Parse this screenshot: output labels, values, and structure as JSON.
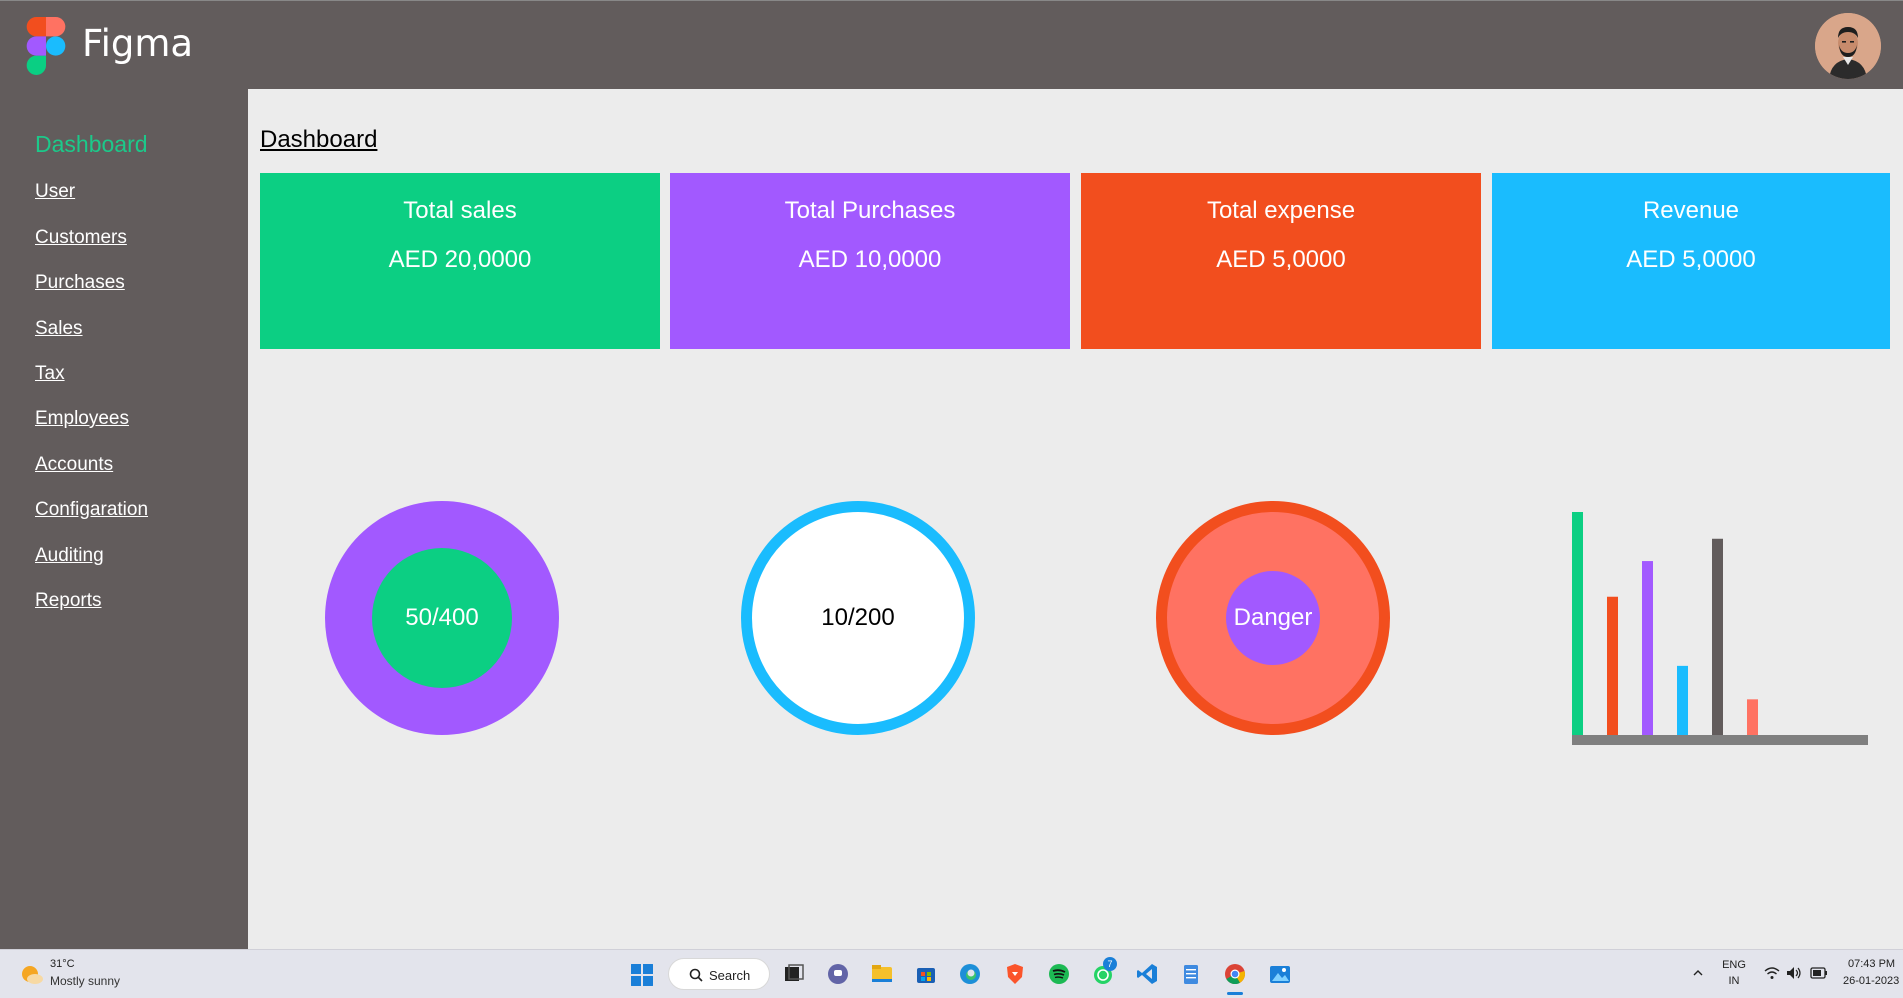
{
  "app": {
    "name": "Figma"
  },
  "sidebar": {
    "active": "Dashboard",
    "items": [
      {
        "label": "User"
      },
      {
        "label": "Customers"
      },
      {
        "label": "Purchases"
      },
      {
        "label": "Sales"
      },
      {
        "label": "Tax"
      },
      {
        "label": "Employees"
      },
      {
        "label": "Accounts"
      },
      {
        "label": "Configaration"
      },
      {
        "label": "Auditing"
      },
      {
        "label": "Reports"
      }
    ]
  },
  "main": {
    "title": "Dashboard",
    "cards": [
      {
        "title": "Total sales",
        "value": "AED 20,0000",
        "color": "#0ccf83"
      },
      {
        "title": "Total Purchases",
        "value": "AED 10,0000",
        "color": "#a259ff"
      },
      {
        "title": "Total expense",
        "value": "AED 5,0000",
        "color": "#f24e1e"
      },
      {
        "title": "Revenue",
        "value": "AED 5,0000",
        "color": "#1abcfe"
      }
    ],
    "rings": [
      {
        "label": "50/400",
        "outer_color": "#a259ff",
        "inner_color": "#0ccf83"
      },
      {
        "label": "10/200",
        "ring_color": "#1abcfe"
      },
      {
        "label": "Danger",
        "outer_color": "#f24e1e",
        "fill_color": "#ff7262",
        "inner_color": "#a259ff"
      }
    ]
  },
  "chart_data": {
    "type": "bar",
    "categories": [
      "",
      "",
      "",
      "",
      "",
      ""
    ],
    "values": [
      100,
      62,
      78,
      31,
      88,
      16
    ],
    "colors": [
      "#0ccf83",
      "#f24e1e",
      "#a259ff",
      "#1abcfe",
      "#625c5c",
      "#ff7262"
    ],
    "ylim": [
      0,
      100
    ],
    "grid": false,
    "axis_color": "#7f7f7f"
  },
  "taskbar": {
    "weather_temp": "31°C",
    "weather_condition": "Mostly sunny",
    "search_label": "Search",
    "whatsapp_badge": "7",
    "lang_line1": "ENG",
    "lang_line2": "IN",
    "time": "07:43 PM",
    "date": "26-01-2023"
  },
  "colors": {
    "header_bg": "#625c5c",
    "sidebar_bg": "#625c5c",
    "content_bg": "#ececec",
    "active_nav": "#1cc98a"
  }
}
